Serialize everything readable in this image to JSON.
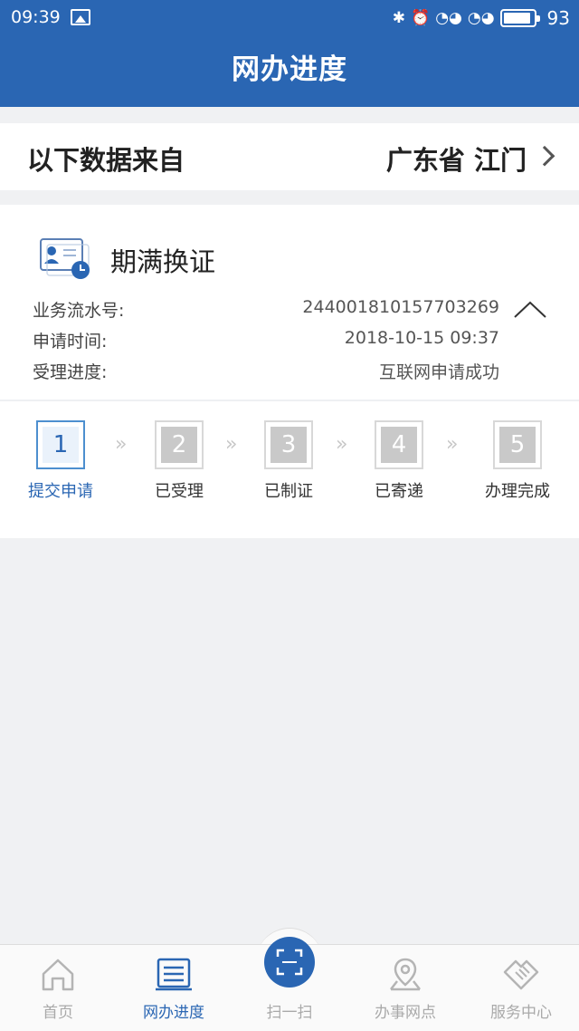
{
  "status_bar": {
    "time": "09:39",
    "battery_level": "93",
    "battery_fraction": 0.93,
    "icons": [
      "image-icon",
      "bluetooth-icon",
      "alarm-icon",
      "hd-signal-icon",
      "4g-signal-icon",
      "battery-icon"
    ]
  },
  "header": {
    "title": "网办进度"
  },
  "source": {
    "label": "以下数据来自",
    "region": "广东省 江门"
  },
  "item": {
    "title": "期满换证",
    "rows": [
      {
        "label": "业务流水号:",
        "value": "244001810157703269"
      },
      {
        "label": "申请时间:",
        "value": "2018-10-15 09:37"
      },
      {
        "label": "受理进度:",
        "value": "互联网申请成功"
      }
    ]
  },
  "steps": [
    {
      "number": "1",
      "label": "提交申请",
      "active": true
    },
    {
      "number": "2",
      "label": "已受理",
      "active": false
    },
    {
      "number": "3",
      "label": "已制证",
      "active": false
    },
    {
      "number": "4",
      "label": "已寄递",
      "active": false
    },
    {
      "number": "5",
      "label": "办理完成",
      "active": false
    }
  ],
  "step_separator": "»",
  "tabs": [
    {
      "label": "首页",
      "icon": "home-icon",
      "active": false
    },
    {
      "label": "网办进度",
      "icon": "progress-list-icon",
      "active": true
    },
    {
      "label": "扫一扫",
      "icon": "scan-icon",
      "active": false
    },
    {
      "label": "办事网点",
      "icon": "map-pin-icon",
      "active": false
    },
    {
      "label": "服务中心",
      "icon": "handshake-icon",
      "active": false
    }
  ],
  "colors": {
    "primary": "#2a66b3",
    "inactive": "#a9a9a9",
    "background": "#f0f1f3"
  }
}
